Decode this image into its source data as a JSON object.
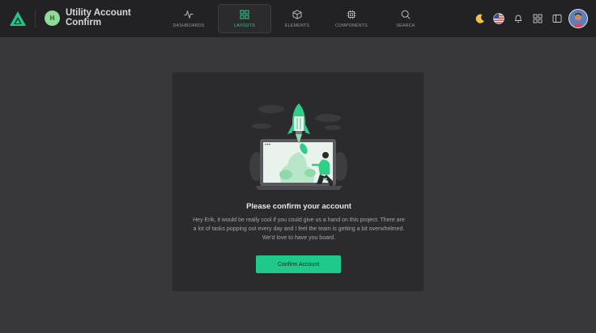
{
  "header": {
    "app_initial": "H",
    "app_title": "Utility Account Confirm",
    "nav": [
      {
        "label": "DASHBOARDS",
        "icon": "activity-icon",
        "active": false
      },
      {
        "label": "LAYOUTS",
        "icon": "grid-icon",
        "active": true
      },
      {
        "label": "ELEMENTS",
        "icon": "cube-icon",
        "active": false
      },
      {
        "label": "COMPONENTS",
        "icon": "cpu-icon",
        "active": false
      },
      {
        "label": "SEARCH",
        "icon": "search-icon",
        "active": false
      }
    ],
    "tools": [
      "moon-icon",
      "us-flag-icon",
      "bell-icon",
      "apps-grid-icon",
      "sidebar-toggle-icon",
      "user-avatar"
    ]
  },
  "card": {
    "title": "Please confirm your account",
    "text": "Hey Erik, it would be really cool if you could give us a hand on this project. There are a lot of tasks popping out every day and I feel the team is getting a bit overwhelmed. We'd love to have you board.",
    "button_label": "Confirm Account"
  },
  "colors": {
    "accent": "#1ec98a",
    "topbar": "#222224",
    "background": "#38383b",
    "card": "#2b2b2d"
  }
}
